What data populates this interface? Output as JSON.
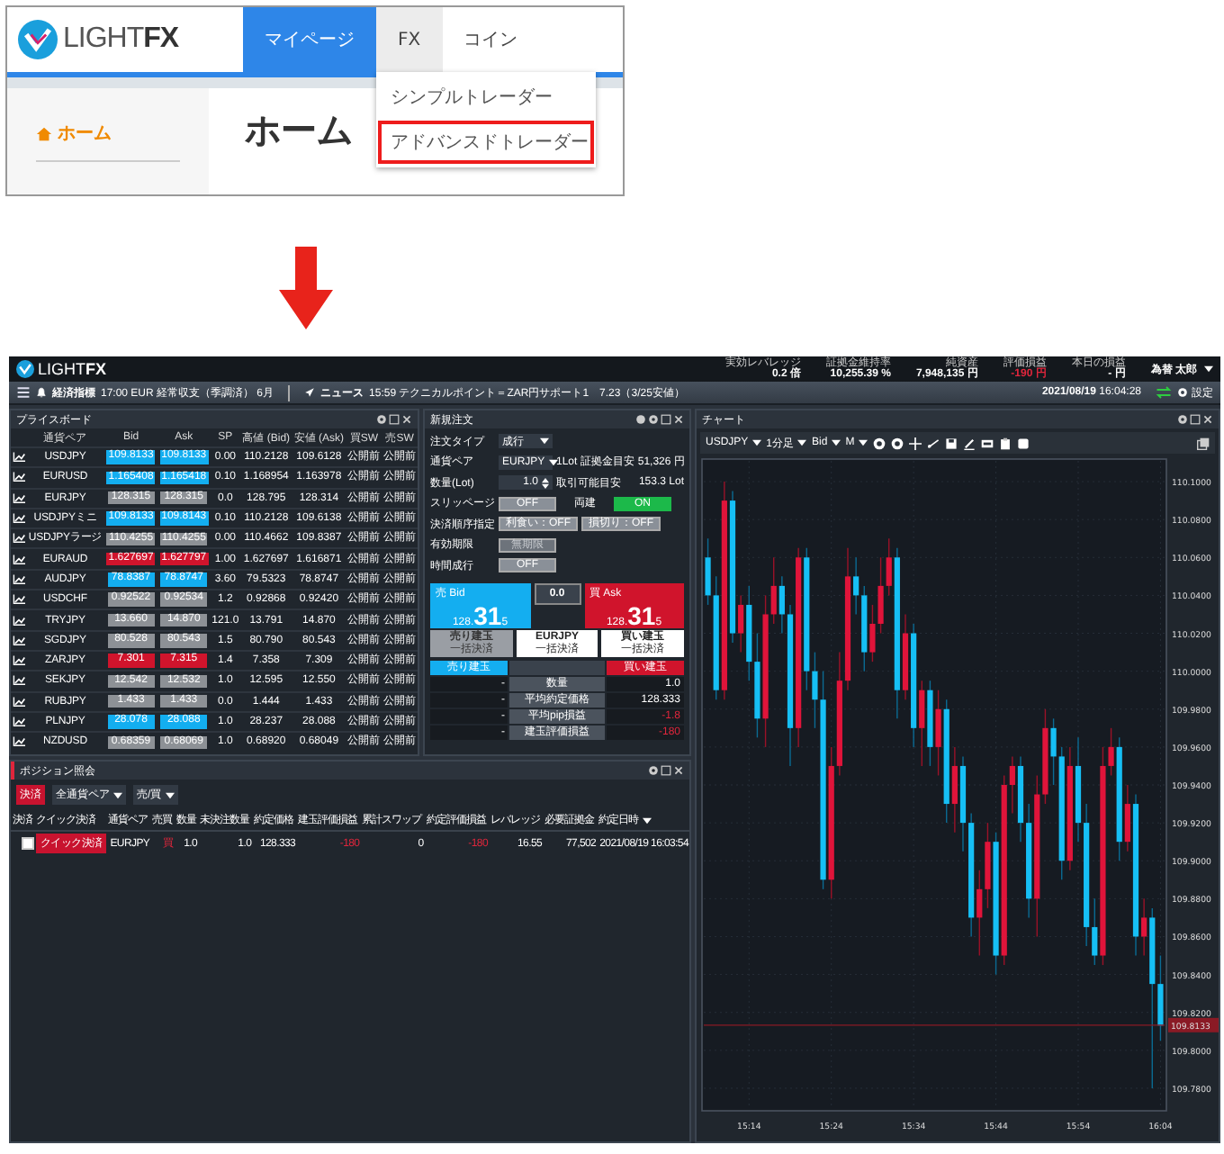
{
  "site": {
    "logo": {
      "word": "LIGHT",
      "mark": "FX"
    },
    "tabs": [
      {
        "label": "マイページ",
        "selected": true,
        "expanded": false
      },
      {
        "label": "FX",
        "selected": false,
        "expanded": true
      },
      {
        "label": "コイン",
        "selected": false,
        "expanded": false
      }
    ],
    "dropdown": [
      {
        "label": "シンプルトレーダー",
        "highlighted": false,
        "external": false
      },
      {
        "label": "アドバンスドトレーダー",
        "highlighted": true,
        "external": true
      }
    ],
    "sidebar": [
      {
        "label": "ホーム",
        "selected": true
      }
    ],
    "heading": "ホーム"
  },
  "app": {
    "logo": {
      "word": "LIGHT",
      "mark": "FX"
    },
    "stats": [
      {
        "label": "実効レバレッジ",
        "value": "0.2 倍",
        "alert": false
      },
      {
        "label": "証拠金維持率",
        "value": "10,255.39 %",
        "alert": false
      },
      {
        "label": "純資産",
        "value": "7,948,135 円",
        "alert": false
      },
      {
        "label": "評価損益",
        "value": "-190 円",
        "alert": true
      },
      {
        "label": "本日の損益",
        "value": "- 円",
        "alert": false
      }
    ],
    "user": "為替 太郎",
    "ticker": [
      {
        "kind": "indicator",
        "label": "経済指標",
        "text": "17:00 EUR 経常収支（季調済） 6月"
      },
      {
        "kind": "news",
        "label": "ニュース",
        "text": "15:59 テクニカルポイント＝ZAR円サポート1　7.23（3/25安値）"
      }
    ],
    "clock": "**2021/08/19** 16:04:28",
    "settings": "設定"
  },
  "price_board": {
    "title": "プライスボード",
    "columns": [
      "通貨ペア",
      "Bid",
      "Ask",
      "SP",
      "高値 (Bid)",
      "安値 (Ask)",
      "買SW",
      "売SW"
    ],
    "rows": [
      {
        "pair": "USDJPY",
        "bid": "109.8133",
        "ask": "109.8133",
        "sp": "0.00",
        "high": "110.2128",
        "low": "109.6128",
        "buy_sw": "公開前",
        "sell_sw": "公開前",
        "color": "#13aef0"
      },
      {
        "pair": "EURUSD",
        "bid": "1.165408",
        "ask": "1.165418",
        "sp": "0.10",
        "high": "1.168954",
        "low": "1.163978",
        "buy_sw": "公開前",
        "sell_sw": "公開前",
        "color": "#13aef0"
      },
      {
        "pair": "EURJPY",
        "bid": "128.315",
        "ask": "128.315",
        "sp": "0.0",
        "high": "128.795",
        "low": "128.314",
        "buy_sw": "公開前",
        "sell_sw": "公開前",
        "color": "#8d9196"
      },
      {
        "pair": "USDJPYミニ",
        "bid": "109.8133",
        "ask": "109.8143",
        "sp": "0.10",
        "high": "110.2128",
        "low": "109.6138",
        "buy_sw": "公開前",
        "sell_sw": "公開前",
        "color": "#13aef0"
      },
      {
        "pair": "USDJPYラージ",
        "bid": "110.4255",
        "ask": "110.4255",
        "sp": "0.00",
        "high": "110.4662",
        "low": "109.8387",
        "buy_sw": "公開前",
        "sell_sw": "公開前",
        "color": "#8d9196"
      },
      {
        "pair": "EURAUD",
        "bid": "1.627697",
        "ask": "1.627797",
        "sp": "1.00",
        "high": "1.627697",
        "low": "1.616871",
        "buy_sw": "公開前",
        "sell_sw": "公開前",
        "color": "#d0142c"
      },
      {
        "pair": "AUDJPY",
        "bid": "78.8387",
        "ask": "78.8747",
        "sp": "3.60",
        "high": "79.5323",
        "low": "78.8747",
        "buy_sw": "公開前",
        "sell_sw": "公開前",
        "color": "#13aef0"
      },
      {
        "pair": "USDCHF",
        "bid": "0.92522",
        "ask": "0.92534",
        "sp": "1.2",
        "high": "0.92868",
        "low": "0.92420",
        "buy_sw": "公開前",
        "sell_sw": "公開前",
        "color": "#8d9196"
      },
      {
        "pair": "TRYJPY",
        "bid": "13.660",
        "ask": "14.870",
        "sp": "121.0",
        "high": "13.791",
        "low": "14.870",
        "buy_sw": "公開前",
        "sell_sw": "公開前",
        "color": "#8d9196"
      },
      {
        "pair": "SGDJPY",
        "bid": "80.528",
        "ask": "80.543",
        "sp": "1.5",
        "high": "80.790",
        "low": "80.543",
        "buy_sw": "公開前",
        "sell_sw": "公開前",
        "color": "#8d9196"
      },
      {
        "pair": "ZARJPY",
        "bid": "7.301",
        "ask": "7.315",
        "sp": "1.4",
        "high": "7.358",
        "low": "7.309",
        "buy_sw": "公開前",
        "sell_sw": "公開前",
        "color": "#d0142c"
      },
      {
        "pair": "SEKJPY",
        "bid": "12.542",
        "ask": "12.532",
        "sp": "1.0",
        "high": "12.595",
        "low": "12.550",
        "buy_sw": "公開前",
        "sell_sw": "公開前",
        "color": "#8d9196"
      },
      {
        "pair": "RUBJPY",
        "bid": "1.433",
        "ask": "1.433",
        "sp": "0.0",
        "high": "1.444",
        "low": "1.433",
        "buy_sw": "公開前",
        "sell_sw": "公開前",
        "color": "#8d9196"
      },
      {
        "pair": "PLNJPY",
        "bid": "28.078",
        "ask": "28.088",
        "sp": "1.0",
        "high": "28.237",
        "low": "28.088",
        "buy_sw": "公開前",
        "sell_sw": "公開前",
        "color": "#13aef0"
      },
      {
        "pair": "NZDUSD",
        "bid": "0.68359",
        "ask": "0.68069",
        "sp": "1.0",
        "high": "0.68920",
        "low": "0.68049",
        "buy_sw": "公開前",
        "sell_sw": "公開前",
        "color": "#8d9196"
      }
    ]
  },
  "order": {
    "title": "新規注文",
    "order_type": {
      "label": "注文タイプ",
      "value": "成行"
    },
    "pair": {
      "label": "通貨ペア",
      "value": "EURJPY"
    },
    "margin": {
      "label": "1Lot 証拠金目安",
      "value": "51,326 円"
    },
    "quantity": {
      "label": "数量(Lot)",
      "value": "1.0"
    },
    "tradable": {
      "label": "取引可能目安",
      "value": "153.3 Lot"
    },
    "slippage": {
      "label": "スリッページ",
      "value": "OFF",
      "on": false
    },
    "hedge": {
      "label": "両建",
      "value": "ON",
      "on": true
    },
    "settlement": {
      "label": "決済順序指定",
      "buttons": [
        "利食い：OFF",
        "損切り：OFF"
      ]
    },
    "expiry": {
      "label": "有効期限",
      "value": "無期限",
      "disabled": true
    },
    "time_market": {
      "label": "時間成行",
      "value": "OFF",
      "on": false
    },
    "sell": {
      "label": "売 Bid",
      "head": "128.",
      "big": "31",
      "tail": "5"
    },
    "spread": "0.0",
    "buy": {
      "label": "買 Ask",
      "head": "128.",
      "big": "31",
      "tail": "5"
    },
    "bulk": [
      {
        "title": "売り建玉",
        "sub": "一括決済",
        "disabled": true
      },
      {
        "title": "EURJPY",
        "sub": "一括決済",
        "disabled": false
      },
      {
        "title": "買い建玉",
        "sub": "一括決済",
        "disabled": false
      }
    ],
    "summary": {
      "sell_head": "売り建玉",
      "buy_head": "買い建玉",
      "rows": [
        {
          "sell": "-",
          "label": "数量",
          "buy": "1.0",
          "alert": false
        },
        {
          "sell": "-",
          "label": "平均約定価格",
          "buy": "128.333",
          "alert": false
        },
        {
          "sell": "-",
          "label": "平均pip損益",
          "buy": "-1.8",
          "alert": true
        },
        {
          "sell": "-",
          "label": "建玉評価損益",
          "buy": "-180",
          "alert": true
        }
      ]
    }
  },
  "positions": {
    "title": "ポジション照会",
    "settle": "決済",
    "filters": [
      "全通貨ペア",
      "売/買"
    ],
    "columns": [
      "決済",
      "クイック決済",
      "通貨ペア",
      "売買",
      "数量",
      "未決注数量",
      "約定価格",
      "建玉評価損益",
      "累計スワップ",
      "約定評価損益",
      "レバレッジ",
      "必要証拠金",
      "約定日時"
    ],
    "rows": [
      {
        "cells": [
          {
            "kind": "checkbox",
            "checked": false
          },
          {
            "kind": "button",
            "text": "クイック決済"
          },
          {
            "kind": "text",
            "text": "EURJPY",
            "alert": false
          },
          {
            "kind": "text",
            "text": "買",
            "alert": true
          },
          {
            "kind": "text",
            "text": "1.0",
            "alert": false
          },
          {
            "kind": "text",
            "text": "1.0",
            "alert": false
          },
          {
            "kind": "text",
            "text": "128.333",
            "alert": false
          },
          {
            "kind": "text",
            "text": "-180",
            "alert": true
          },
          {
            "kind": "text",
            "text": "0",
            "alert": false
          },
          {
            "kind": "text",
            "text": "-180",
            "alert": true
          },
          {
            "kind": "text",
            "text": "16.55",
            "alert": false
          },
          {
            "kind": "text",
            "text": "77,502",
            "alert": false
          },
          {
            "kind": "text",
            "text": "2021/08/19 16:03:54",
            "alert": false
          }
        ]
      }
    ]
  },
  "chart": {
    "title": "チャート",
    "symbol": "USDJPY",
    "interval": "1分足",
    "side": "Bid",
    "type": "M",
    "chart_data": {
      "type": "candlestick",
      "categories": [
        null,
        null,
        null,
        null,
        null,
        "15:14",
        null,
        null,
        null,
        null,
        null,
        null,
        null,
        null,
        null,
        "15:24",
        null,
        null,
        null,
        null,
        null,
        null,
        null,
        null,
        null,
        "15:34",
        null,
        null,
        null,
        null,
        null,
        null,
        null,
        null,
        null,
        "15:44",
        null,
        null,
        null,
        null,
        null,
        null,
        null,
        null,
        null,
        "15:54",
        null,
        null,
        null,
        null,
        null,
        null,
        null,
        null,
        null,
        "16:04"
      ],
      "grid": true,
      "ohlc": [
        [
          110.06,
          110.07,
          110.035,
          110.04
        ],
        [
          110.04,
          110.05,
          109.985,
          109.99
        ],
        [
          109.99,
          110.1,
          109.985,
          110.09
        ],
        [
          110.09,
          110.095,
          110.015,
          110.02
        ],
        [
          110.02,
          110.04,
          110.01,
          110.035
        ],
        [
          110.035,
          110.045,
          109.995,
          110.005
        ],
        [
          110.005,
          110.02,
          109.965,
          109.975
        ],
        [
          109.975,
          110.04,
          109.96,
          110.03
        ],
        [
          110.03,
          110.06,
          110.025,
          110.045
        ],
        [
          110.045,
          110.05,
          110.02,
          110.03
        ],
        [
          110.03,
          110.035,
          109.95,
          109.97
        ],
        [
          109.97,
          110.065,
          109.96,
          110.06
        ],
        [
          110.06,
          110.065,
          109.99,
          110.0
        ],
        [
          110.0,
          110.01,
          109.97,
          109.985
        ],
        [
          109.985,
          110.0,
          109.885,
          109.89
        ],
        [
          109.89,
          109.96,
          109.88,
          109.95
        ],
        [
          109.95,
          110.01,
          109.945,
          109.995
        ],
        [
          109.995,
          110.065,
          109.99,
          110.05
        ],
        [
          110.05,
          110.06,
          110.03,
          110.04
        ],
        [
          110.04,
          110.045,
          110.0,
          110.01
        ],
        [
          110.01,
          110.035,
          110.005,
          110.025
        ],
        [
          110.025,
          110.06,
          110.02,
          110.045
        ],
        [
          110.045,
          110.07,
          110.04,
          110.06
        ],
        [
          110.06,
          110.065,
          109.975,
          109.99
        ],
        [
          109.99,
          110.03,
          109.985,
          110.02
        ],
        [
          110.02,
          110.025,
          109.96,
          109.97
        ],
        [
          109.97,
          109.995,
          109.95,
          109.99
        ],
        [
          109.99,
          109.995,
          109.95,
          109.96
        ],
        [
          109.96,
          109.99,
          109.945,
          109.98
        ],
        [
          109.98,
          109.985,
          109.92,
          109.93
        ],
        [
          109.93,
          109.96,
          109.915,
          109.95
        ],
        [
          109.95,
          109.955,
          109.905,
          109.92
        ],
        [
          109.92,
          109.925,
          109.86,
          109.87
        ],
        [
          109.87,
          109.895,
          109.85,
          109.885
        ],
        [
          109.885,
          109.92,
          109.875,
          109.91
        ],
        [
          109.91,
          109.915,
          109.84,
          109.85
        ],
        [
          109.85,
          109.945,
          109.845,
          109.94
        ],
        [
          109.94,
          109.955,
          109.925,
          109.95
        ],
        [
          109.95,
          109.955,
          109.91,
          109.92
        ],
        [
          109.92,
          109.93,
          109.87,
          109.88
        ],
        [
          109.88,
          109.945,
          109.86,
          109.935
        ],
        [
          109.935,
          109.98,
          109.93,
          109.97
        ],
        [
          109.97,
          109.975,
          109.94,
          109.955
        ],
        [
          109.955,
          109.96,
          109.89,
          109.9
        ],
        [
          109.9,
          109.96,
          109.895,
          109.95
        ],
        [
          109.95,
          109.965,
          109.91,
          109.92
        ],
        [
          109.92,
          109.93,
          109.855,
          109.865
        ],
        [
          109.865,
          109.88,
          109.845,
          109.85
        ],
        [
          109.85,
          109.96,
          109.845,
          109.95
        ],
        [
          109.95,
          109.97,
          109.945,
          109.96
        ],
        [
          109.96,
          109.965,
          109.9,
          109.91
        ],
        [
          109.91,
          109.94,
          109.905,
          109.93
        ],
        [
          109.93,
          109.935,
          109.85,
          109.86
        ],
        [
          109.86,
          109.88,
          109.85,
          109.87
        ],
        [
          109.87,
          109.875,
          109.78,
          109.835
        ],
        [
          109.835,
          109.85,
          109.805,
          109.813
        ]
      ],
      "ylim": [
        109.77,
        110.11
      ],
      "yticks": [
        {
          "value": 110.1,
          "label": "110.1000"
        },
        {
          "value": 110.08,
          "label": "110.0800"
        },
        {
          "value": 110.06,
          "label": "110.0600"
        },
        {
          "value": 110.04,
          "label": "110.0400"
        },
        {
          "value": 110.02,
          "label": "110.0200"
        },
        {
          "value": 110.0,
          "label": "110.0000"
        },
        {
          "value": 109.98,
          "label": "109.9800"
        },
        {
          "value": 109.96,
          "label": "109.9600"
        },
        {
          "value": 109.94,
          "label": "109.9400"
        },
        {
          "value": 109.92,
          "label": "109.9200"
        },
        {
          "value": 109.9,
          "label": "109.9000"
        },
        {
          "value": 109.88,
          "label": "109.8800"
        },
        {
          "value": 109.86,
          "label": "109.8600"
        },
        {
          "value": 109.84,
          "label": "109.8400"
        },
        {
          "value": 109.82,
          "label": "109.8200"
        },
        {
          "value": 109.8,
          "label": "109.8000"
        },
        {
          "value": 109.78,
          "label": "109.7800"
        }
      ],
      "ref_lines": [
        {
          "axis": "y",
          "value": 109.8133,
          "label": "109.8133",
          "color": "#8a1a25"
        }
      ]
    }
  }
}
